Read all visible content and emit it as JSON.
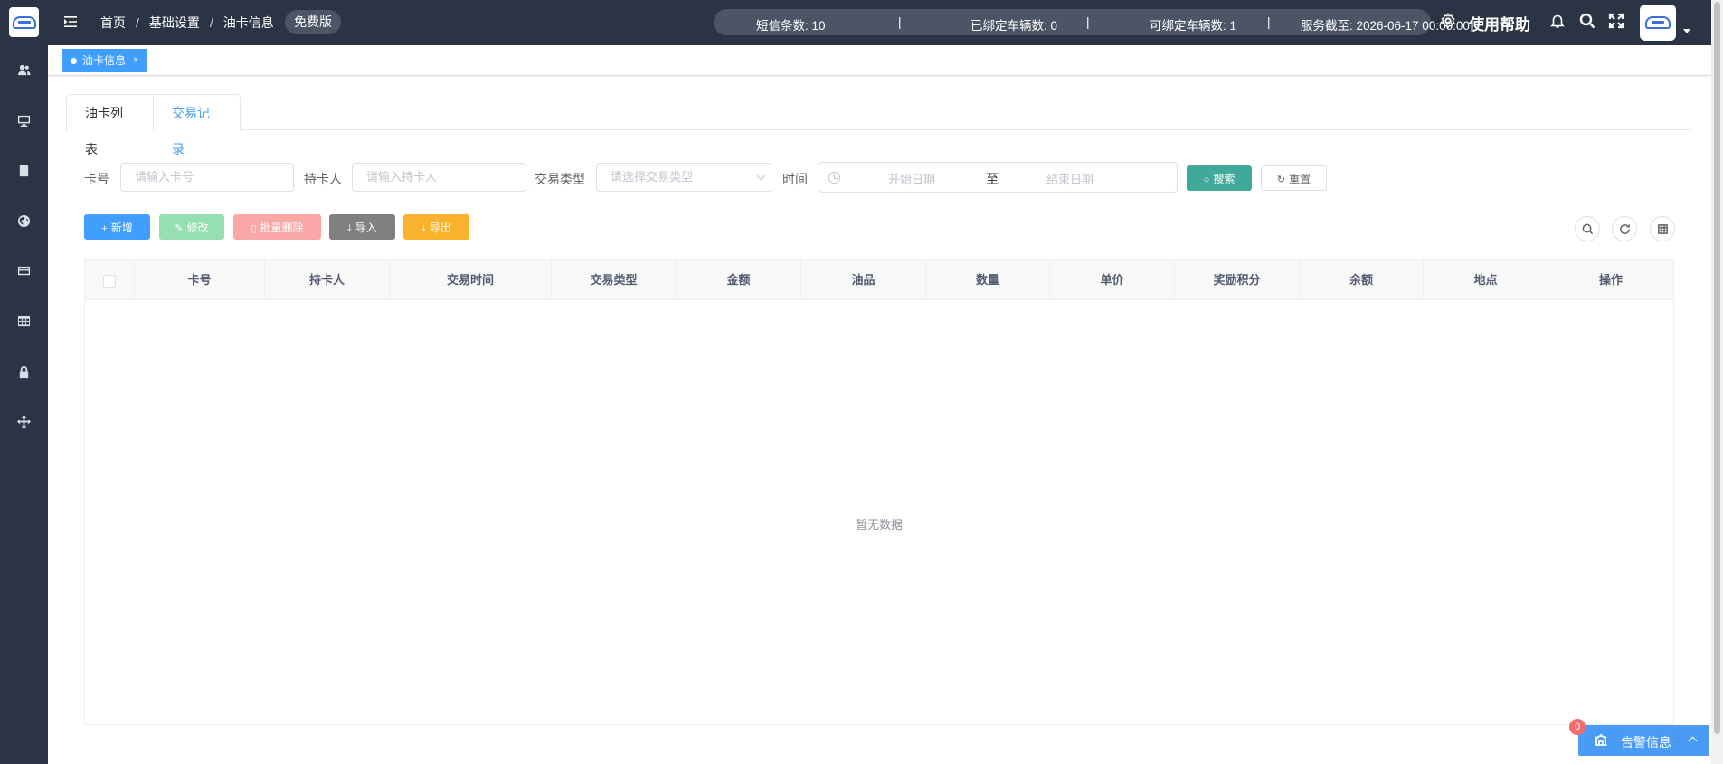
{
  "header": {
    "breadcrumb": [
      "首页",
      "基础设置",
      "油卡信息"
    ],
    "breadcrumb_sep": "/",
    "plan_badge": "免费版",
    "stats": {
      "sms_label": "短信条数: 10",
      "sep": "|",
      "bound_label": "已绑定车辆数: 0",
      "available_label": "可绑定车辆数: 1",
      "expiry_label": "服务截至: 2026-06-17 00:00:00"
    },
    "help_label": "使用帮助"
  },
  "tags_view": {
    "active_tag": "油卡信息",
    "close_glyph": "×"
  },
  "tabs": [
    {
      "label": "油卡列表",
      "active": false
    },
    {
      "label": "交易记录",
      "active": true
    }
  ],
  "search_form": {
    "card_no": {
      "label": "卡号",
      "placeholder": "请输入卡号"
    },
    "holder": {
      "label": "持卡人",
      "placeholder": "请输入持卡人"
    },
    "trade_type": {
      "label": "交易类型",
      "placeholder": "请选择交易类型"
    },
    "time": {
      "label": "时间",
      "start_placeholder": "开始日期",
      "range_sep": "至",
      "end_placeholder": "结束日期"
    },
    "search_label": "搜索",
    "reset_label": "重置"
  },
  "toolbar": {
    "add_label": "新增",
    "edit_label": "修改",
    "batch_delete_label": "批量删除",
    "import_label": "导入",
    "export_label": "导出"
  },
  "table": {
    "columns": [
      "卡号",
      "持卡人",
      "交易时间",
      "交易类型",
      "金额",
      "油品",
      "数量",
      "单价",
      "奖励积分",
      "余额",
      "地点",
      "操作"
    ],
    "rows": [],
    "empty_text": "暂无数据"
  },
  "alarm": {
    "label": "告警信息",
    "count": "0"
  },
  "colors": {
    "sidebar_bg": "#2b3445",
    "primary": "#409eff",
    "search_button": "#41a99a",
    "edit_button": "#95dfb0",
    "delete_button": "#f9a7a7",
    "import_button": "#808080",
    "export_button": "#f9b22d",
    "alarm_badge": "#f56c6c"
  }
}
